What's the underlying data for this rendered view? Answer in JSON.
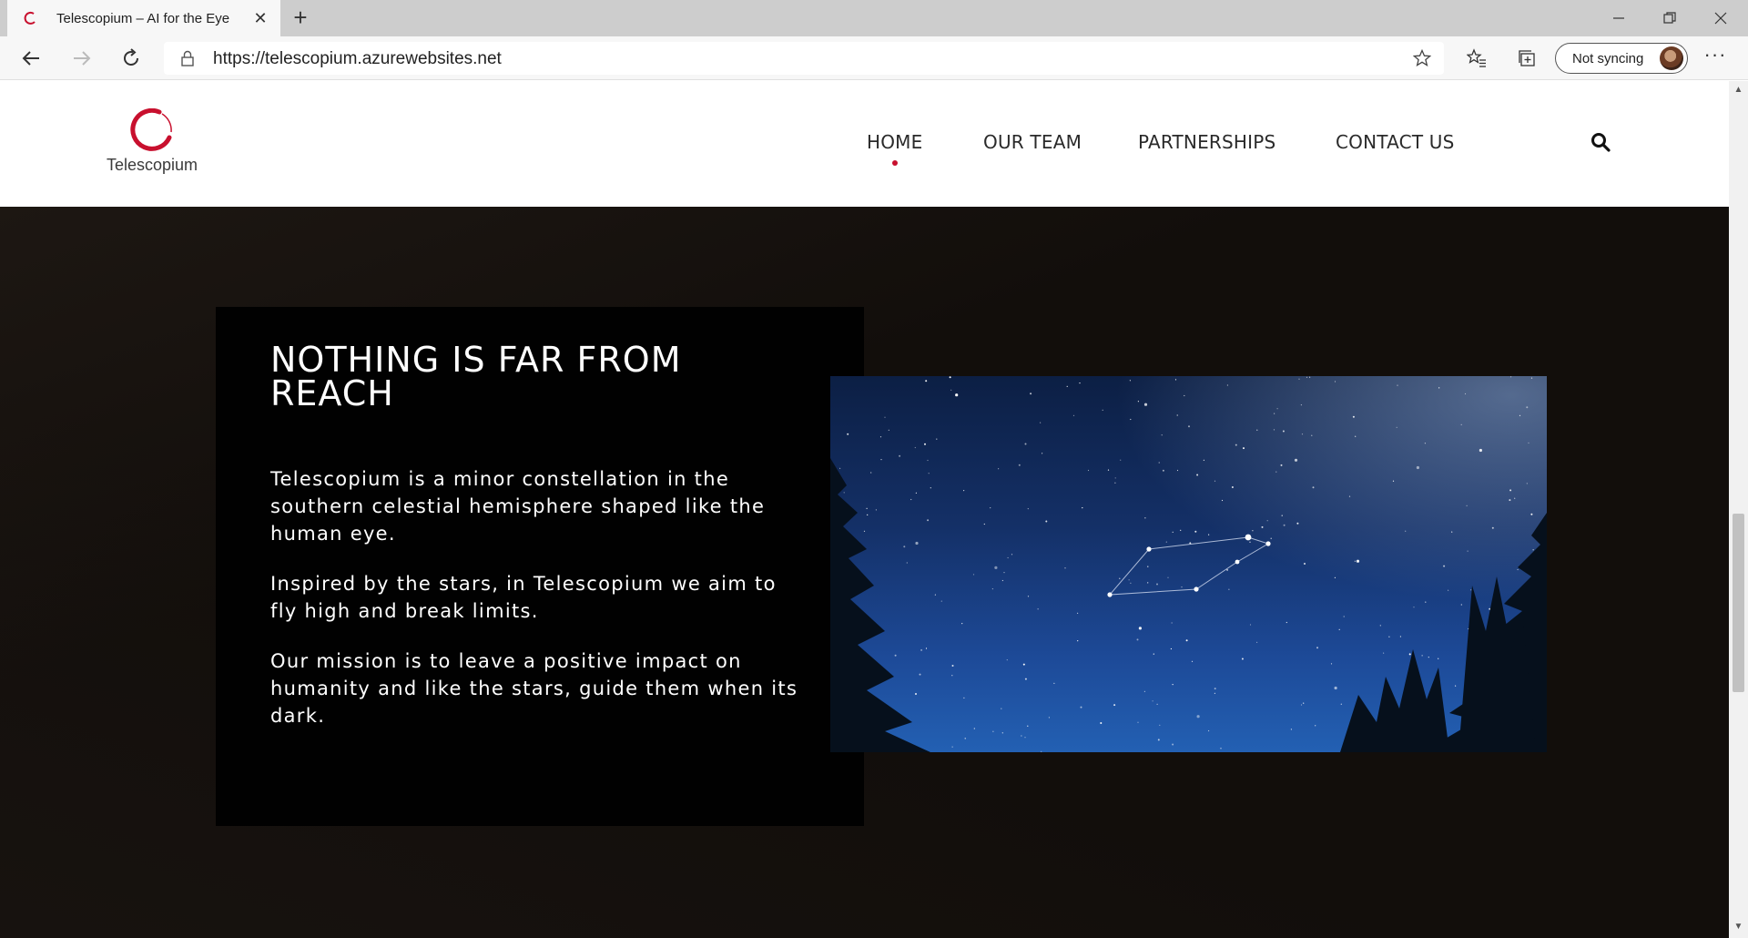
{
  "browser": {
    "tab_title": "Telescopium – AI for the Eye",
    "url": "https://telescopium.azurewebsites.net",
    "sync_label": "Not syncing"
  },
  "site": {
    "logo_text": "Telescopium",
    "brand_color": "#c8102e",
    "nav": [
      {
        "label": "HOME",
        "active": true
      },
      {
        "label": "OUR TEAM",
        "active": false
      },
      {
        "label": "PARTNERSHIPS",
        "active": false
      },
      {
        "label": "CONTACT US",
        "active": false
      }
    ],
    "search_icon": "search-icon"
  },
  "hero": {
    "title": "NOTHING IS FAR FROM REACH",
    "paragraphs": [
      "Telescopium is a minor constellation in the southern celestial hemisphere shaped like the human eye.",
      "Inspired by the stars, in Telescopium we aim to fly high and break limits.",
      "Our mission is to leave a positive impact on humanity and like the stars, guide them when its dark."
    ],
    "image_subject": "night-sky-constellation-image"
  }
}
